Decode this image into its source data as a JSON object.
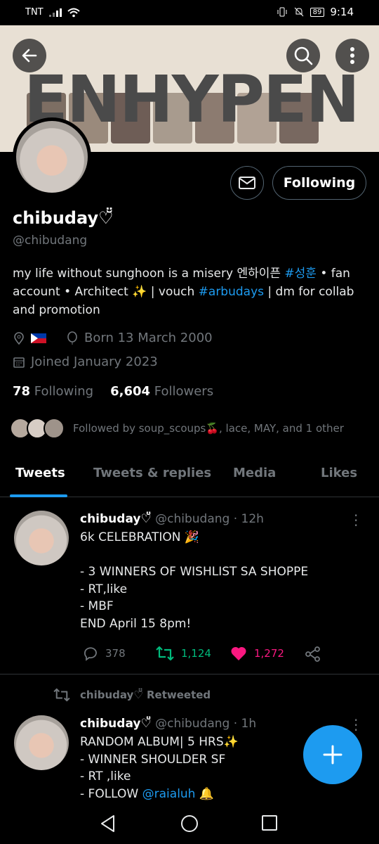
{
  "status_bar": {
    "carrier": "TNT",
    "battery": "89",
    "time": "9:14"
  },
  "banner": {
    "word": "ENHYPEN"
  },
  "profile": {
    "name": "chibuday♡̆̈",
    "handle": "@chibudang",
    "bio_part1": "my life without sunghoon is a misery  엔하이픈 ",
    "bio_tag1": "#성훈",
    "bio_part2": " • fan account • Architect ✨ | vouch ",
    "bio_tag2": "#arbudays",
    "bio_part3": " | dm for collab and promotion",
    "birth": "Born 13 March 2000",
    "joined": "Joined January 2023",
    "following_count": "78",
    "following_label": "Following",
    "followers_count": "6,604",
    "followers_label": "Followers",
    "followed_by": "Followed by soup_scoups🍒, lace, MAY, and 1 other",
    "follow_button": "Following"
  },
  "tabs": [
    "Tweets",
    "Tweets & replies",
    "Media",
    "Likes"
  ],
  "tweet1": {
    "name": "chibuday♡̆̈",
    "meta": "@chibudang · 12h",
    "body": "6k CELEBRATION 🎉\n\n- 3 WINNERS OF WISHLIST SA SHOPPE\n- RT,like\n- MBF\nEND April 15 8pm!",
    "replies": "378",
    "retweets": "1,124",
    "likes": "1,272"
  },
  "retweet_label": "chibuday♡̆̈ Retweeted",
  "tweet2": {
    "name": "chibuday♡̆̈",
    "meta": "@chibudang · 1h",
    "body_lines": "RANDOM ALBUM| 5 HRS✨\n- WINNER SHOULDER SF\n- RT ,like\n- FOLLOW ",
    "mention": "@raialuh",
    "bell": " 🔔"
  },
  "colors": {
    "accent": "#1d9bf0",
    "retweet": "#00ba7c",
    "like": "#f91880",
    "muted": "#71767b"
  }
}
